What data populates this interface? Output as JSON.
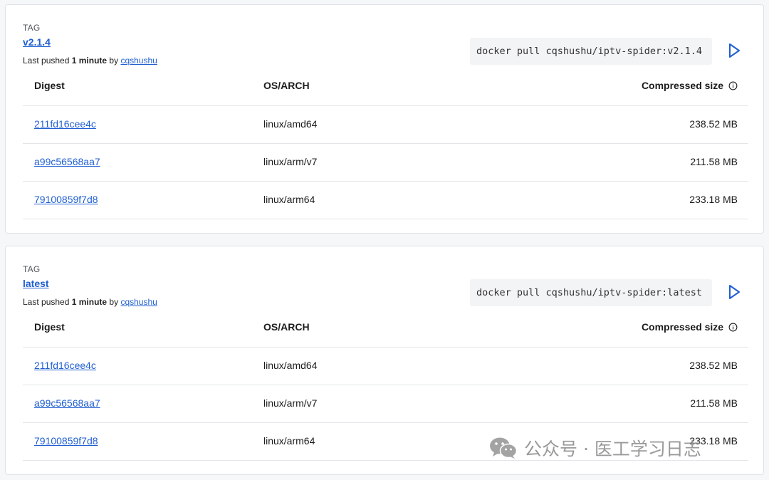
{
  "tags": [
    {
      "tag_label": "TAG",
      "tag_name": "v2.1.4",
      "pushed_prefix": "Last pushed",
      "pushed_time": "1 minute",
      "pushed_by": "by",
      "pushed_user": "cqshushu",
      "pull_command": "docker pull cqshushu/iptv-spider:v2.1.4",
      "headers": {
        "digest": "Digest",
        "os_arch": "OS/ARCH",
        "size": "Compressed size"
      },
      "rows": [
        {
          "digest": "211fd16cee4c",
          "os_arch": "linux/amd64",
          "size": "238.52 MB"
        },
        {
          "digest": "a99c56568aa7",
          "os_arch": "linux/arm/v7",
          "size": "211.58 MB"
        },
        {
          "digest": "79100859f7d8",
          "os_arch": "linux/arm64",
          "size": "233.18 MB"
        }
      ]
    },
    {
      "tag_label": "TAG",
      "tag_name": "latest",
      "pushed_prefix": "Last pushed",
      "pushed_time": "1 minute",
      "pushed_by": "by",
      "pushed_user": "cqshushu",
      "pull_command": "docker pull cqshushu/iptv-spider:latest",
      "headers": {
        "digest": "Digest",
        "os_arch": "OS/ARCH",
        "size": "Compressed size"
      },
      "rows": [
        {
          "digest": "211fd16cee4c",
          "os_arch": "linux/amd64",
          "size": "238.52 MB"
        },
        {
          "digest": "a99c56568aa7",
          "os_arch": "linux/arm/v7",
          "size": "211.58 MB"
        },
        {
          "digest": "79100859f7d8",
          "os_arch": "linux/arm64",
          "size": "233.18 MB"
        }
      ]
    }
  ],
  "watermark": {
    "text": "公众号 · 医工学习日志",
    "icon": "wechat-icon"
  },
  "colors": {
    "link": "#1f5fd1",
    "border": "#dfe2e6",
    "command_bg": "#f3f4f6"
  }
}
